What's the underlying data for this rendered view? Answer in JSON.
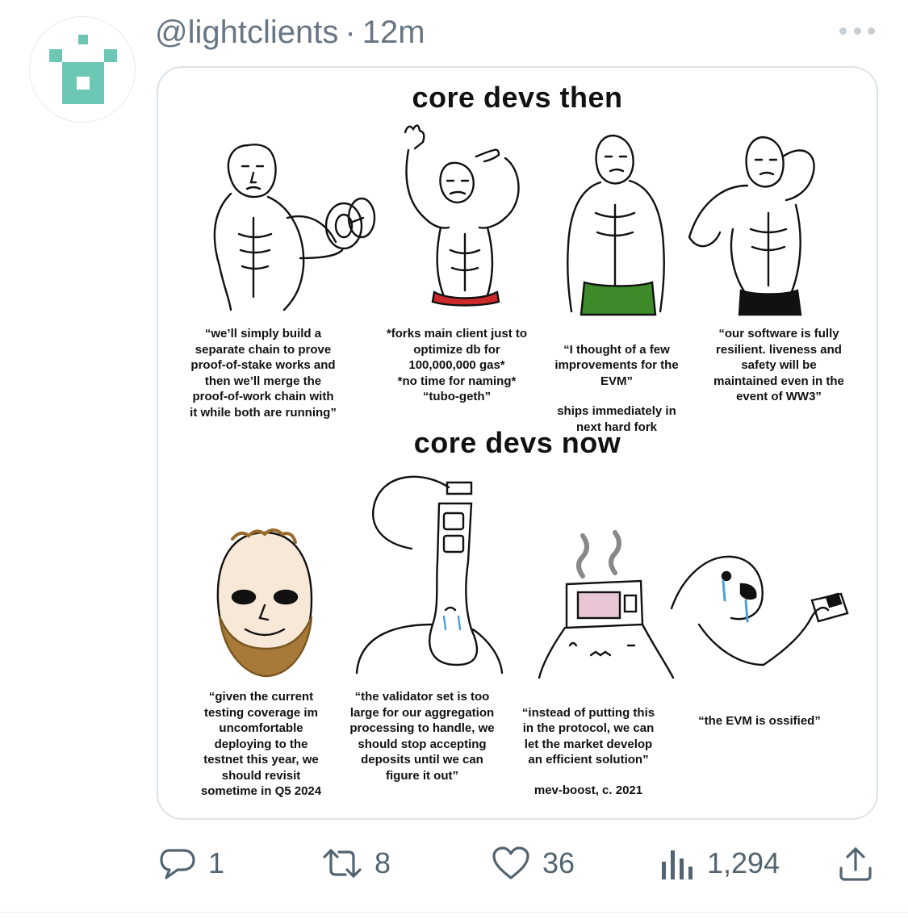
{
  "tweet": {
    "handle": "@lightclients",
    "separator": "·",
    "time": "12m"
  },
  "icons": {
    "avatar": "lightclients-pixel-logo",
    "more": "more-horizontal-icon",
    "reply": "reply-icon",
    "retweet": "retweet-icon",
    "like": "heart-icon",
    "views": "views-chart-icon",
    "share": "share-icon"
  },
  "colors": {
    "avatar_teal": "#6cc7b4",
    "meta_gray": "#687684",
    "action_gray": "#536471",
    "border": "#dde3e8"
  },
  "meme": {
    "title_then": "core devs then",
    "title_now": "core devs now",
    "then_panels": [
      {
        "caption": "“we’ll simply build a\nseparate chain to prove\nproof-of-stake works and\nthen we’ll merge the\nproof-of-work chain with\nit while both are running”"
      },
      {
        "caption": "*forks main client just to\noptimize db for\n100,000,000 gas*\n*no time for naming*\n“tubo-geth”"
      },
      {
        "caption": "“I thought of a few\nimprovements for the\nEVM”",
        "note": "ships immediately in\nnext hard fork"
      },
      {
        "caption": "“our software is fully\nresilient. liveness and\nsafety will be\nmaintained even in the\nevent of WW3”"
      }
    ],
    "now_panels": [
      {
        "caption": "“given the current\ntesting coverage im\nuncomfortable\ndeploying to the\ntestnet this year, we\nshould revisit\nsometime in Q5 2024"
      },
      {
        "caption": "“the validator set is too\nlarge for our aggregation\nprocessing to handle, we\nshould stop accepting\ndeposits until we can\nfigure it out”"
      },
      {
        "caption": "“instead of putting this\nin the protocol, we can\nlet the market develop\nan efficient solution”",
        "note": "mev-boost, c. 2021"
      },
      {
        "caption": "“the EVM is ossified”"
      }
    ]
  },
  "actions": {
    "replies": "1",
    "retweets": "8",
    "likes": "36",
    "views": "1,294"
  }
}
